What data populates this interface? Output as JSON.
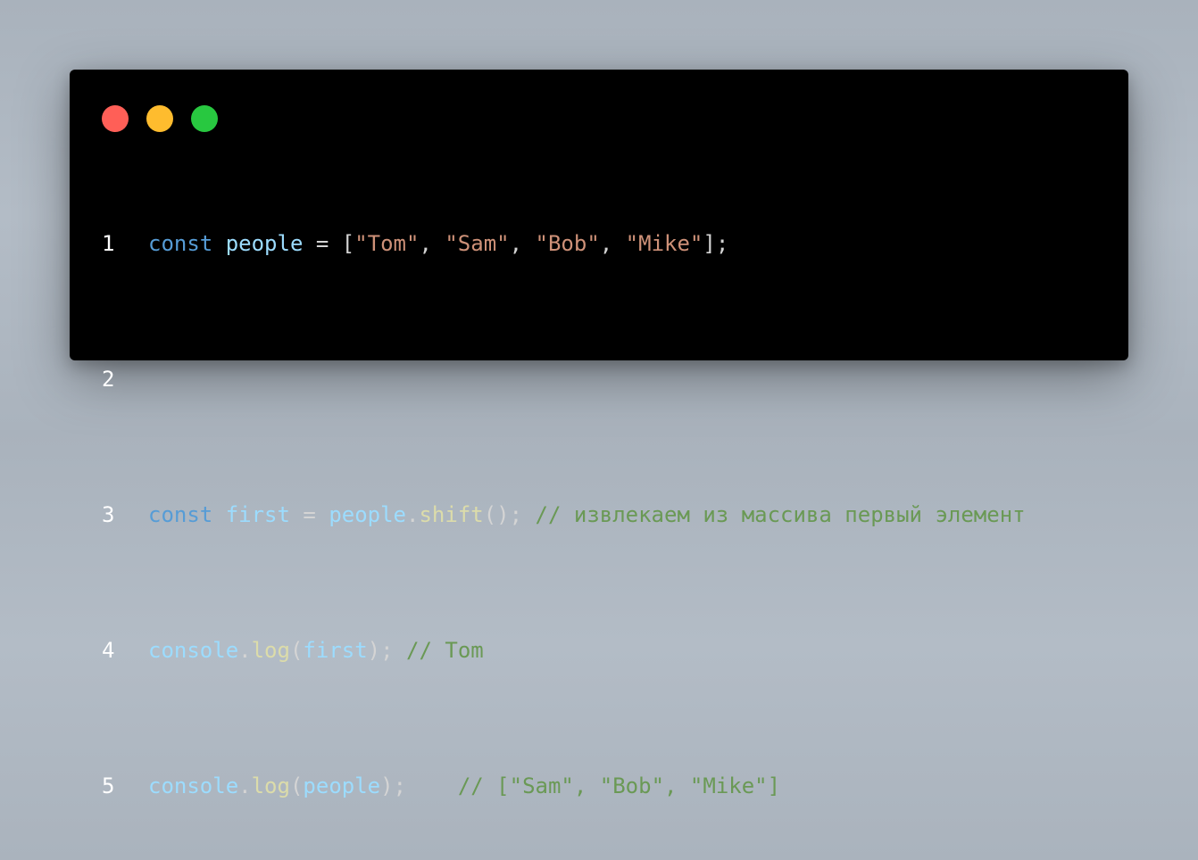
{
  "window": {
    "controls": {
      "close_color": "#ff5f57",
      "minimize_color": "#febc2e",
      "maximize_color": "#28c840"
    }
  },
  "code": {
    "line_numbers": [
      "1",
      "2",
      "3",
      "4",
      "5"
    ],
    "line1": {
      "kw": "const",
      "var": "people",
      "op": " = [",
      "s1": "\"Tom\"",
      "c1": ", ",
      "s2": "\"Sam\"",
      "c2": ", ",
      "s3": "\"Bob\"",
      "c3": ", ",
      "s4": "\"Mike\"",
      "end": "];"
    },
    "line3": {
      "kw": "const",
      "var": "first",
      "op": " = ",
      "obj": "people",
      "dot": ".",
      "fn": "shift",
      "end": "(); ",
      "comment": "// извлекаем из массива первый элемент"
    },
    "line4": {
      "obj": "console",
      "dot": ".",
      "fn": "log",
      "open": "(",
      "arg": "first",
      "end": "); ",
      "comment": "// Tom"
    },
    "line5": {
      "obj": "console",
      "dot": ".",
      "fn": "log",
      "open": "(",
      "arg": "people",
      "end": ");    ",
      "comment": "// [\"Sam\", \"Bob\", \"Mike\"]"
    }
  },
  "colors": {
    "background": "#000000",
    "keyword": "#569cd6",
    "variable": "#9cdcfe",
    "function": "#dcdcaa",
    "string": "#ce9178",
    "comment": "#6a9955"
  }
}
